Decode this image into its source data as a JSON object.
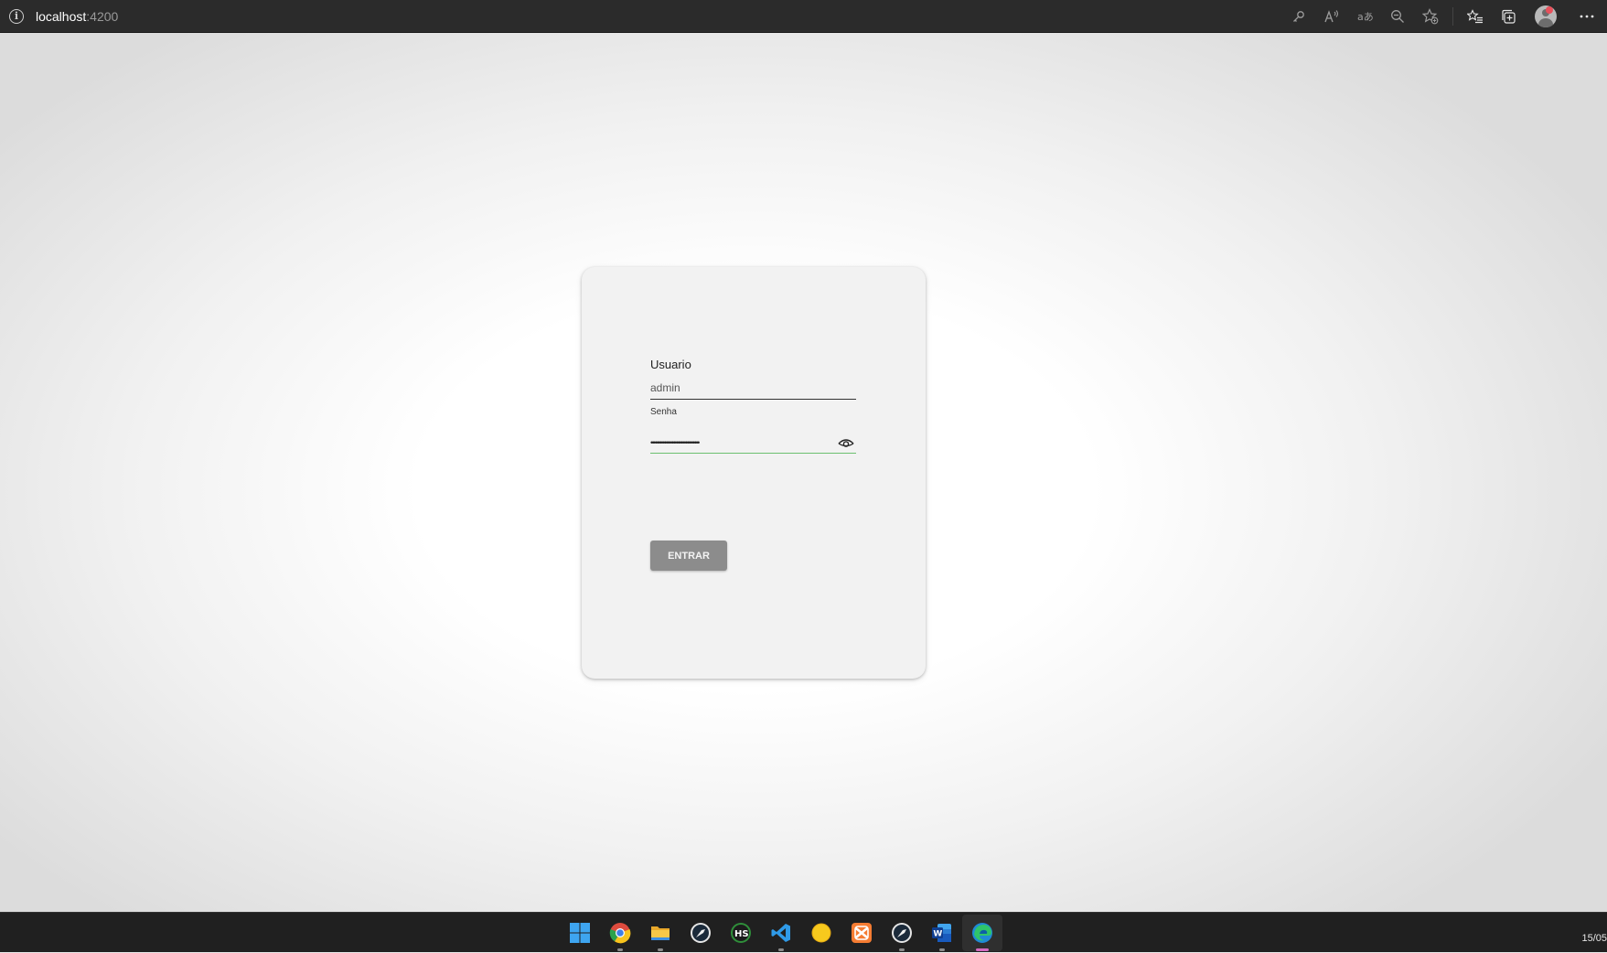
{
  "browser": {
    "host": "localhost",
    "port": ":4200"
  },
  "login": {
    "user_label": "Usuario",
    "user_value": "admin",
    "password_label": "Senha",
    "password_value": "••••••••••••••••••••••••••••••••",
    "submit_label": "ENTRAR"
  },
  "toolbar": {
    "icons": [
      "key-icon",
      "read-aloud-icon",
      "translate-icon",
      "zoom-out-icon",
      "add-favorite-icon",
      "favorites-icon",
      "collections-icon",
      "profile-avatar",
      "more-icon"
    ]
  },
  "taskbar": {
    "apps": [
      "windows-start-icon",
      "chrome-icon",
      "file-explorer-icon",
      "postman-icon",
      "heidisql-icon",
      "vscode-icon",
      "yellow-app-icon",
      "xampp-icon",
      "postman-icon",
      "word-icon",
      "edge-icon"
    ],
    "clock": "15/05"
  },
  "colors": {
    "button_bg": "#8c8c8c",
    "password_underline": "#6cc070",
    "taskbar_bg": "#202020"
  }
}
